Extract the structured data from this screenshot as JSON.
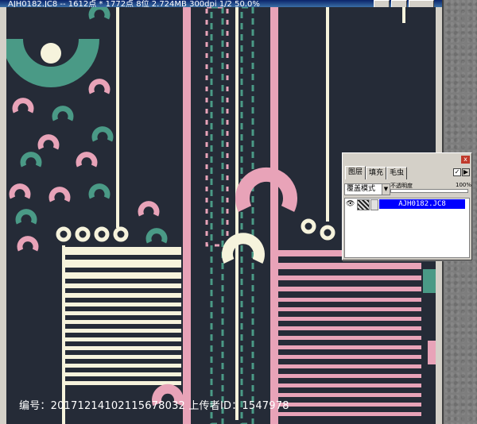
{
  "window": {
    "title": "AJH0182.JC8 -- 1612点 * 1772点 8位  2.724MB 300dpi 1/2  50.0%"
  },
  "colors": {
    "canvas_bg": "#252b37",
    "pink": "#e8a3b8",
    "teal": "#4a9a86",
    "cream": "#f6f3dc",
    "selection": "#0000ff"
  },
  "layers_panel": {
    "close": "x",
    "tabs": [
      "图层",
      "填充",
      "毛虫"
    ],
    "blend_mode": "覆盖模式",
    "opacity_label": "不透明度",
    "opacity_value": "100%",
    "layer_name": "AJH0182.JC8",
    "visibility_icon": "eye-icon"
  },
  "watermark": {
    "text": "编号：20171214102115678032 上传者ID：1547978"
  }
}
